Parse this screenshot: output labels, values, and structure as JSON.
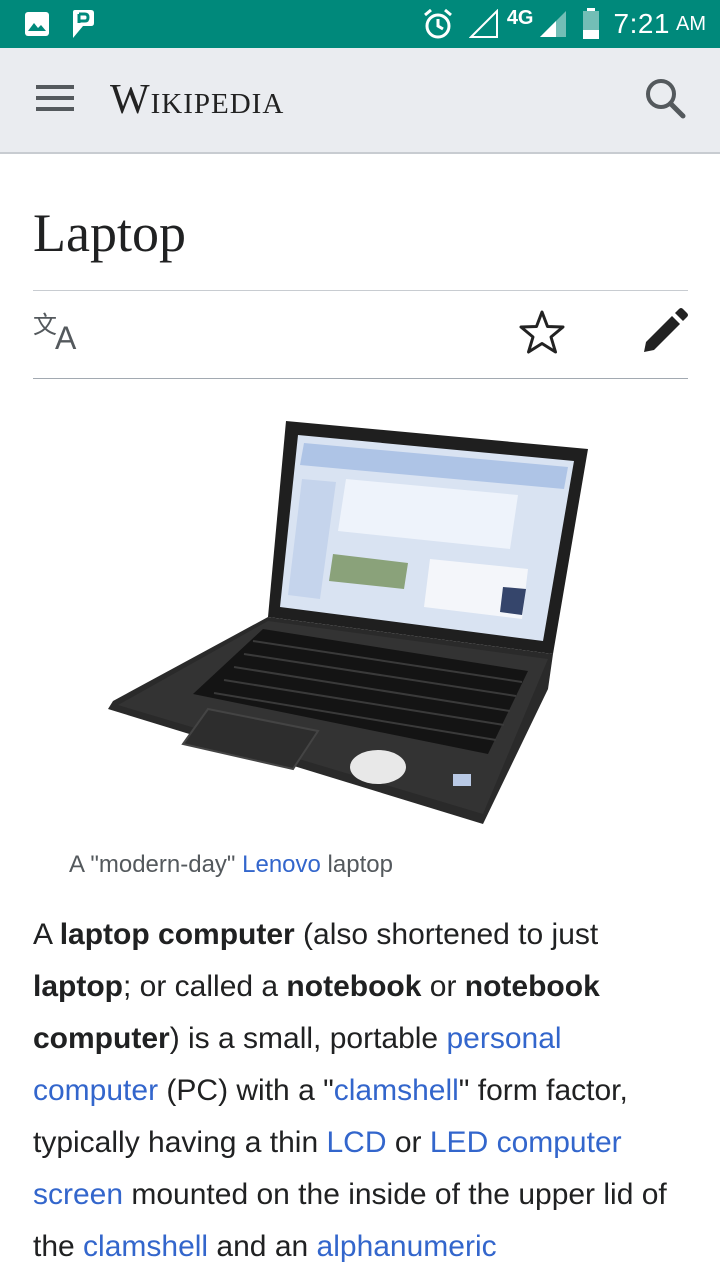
{
  "status_bar": {
    "network": "4G",
    "time": "7:21",
    "ampm": "AM",
    "icons": [
      "image-icon",
      "parking-app-icon",
      "alarm-icon",
      "signal-empty-icon",
      "signal-icon",
      "battery-icon"
    ]
  },
  "header": {
    "logo": "Wikipedia",
    "icons": [
      "menu-icon",
      "search-icon"
    ]
  },
  "article": {
    "title": "Laptop",
    "actions": [
      "language-icon",
      "star-icon",
      "edit-icon"
    ],
    "figure_caption": {
      "pre": "A \"modern-day\" ",
      "link": "Lenovo",
      "post": " laptop"
    },
    "intro": {
      "t1": "A ",
      "b1": "laptop computer",
      "t2": " (also shortened to just ",
      "b2": "laptop",
      "t3": "; or called a ",
      "b3": "notebook",
      "t4": " or ",
      "b4": "notebook computer",
      "t5": ") is a small, portable ",
      "l1": "personal computer",
      "t6": " (PC) with a \"",
      "l2": "clamshell",
      "t7": "\" form factor, typically having a thin ",
      "l3": "LCD",
      "t8": " or ",
      "l4": "LED computer screen",
      "t9": " mounted on the inside of the upper lid of the ",
      "l5": "clamshell",
      "t10": " and an ",
      "l6": "alphanumeric"
    }
  },
  "colors": {
    "status_bar": "#00897b",
    "header": "#eaecf0",
    "link": "#3366cc",
    "text": "#202122"
  }
}
